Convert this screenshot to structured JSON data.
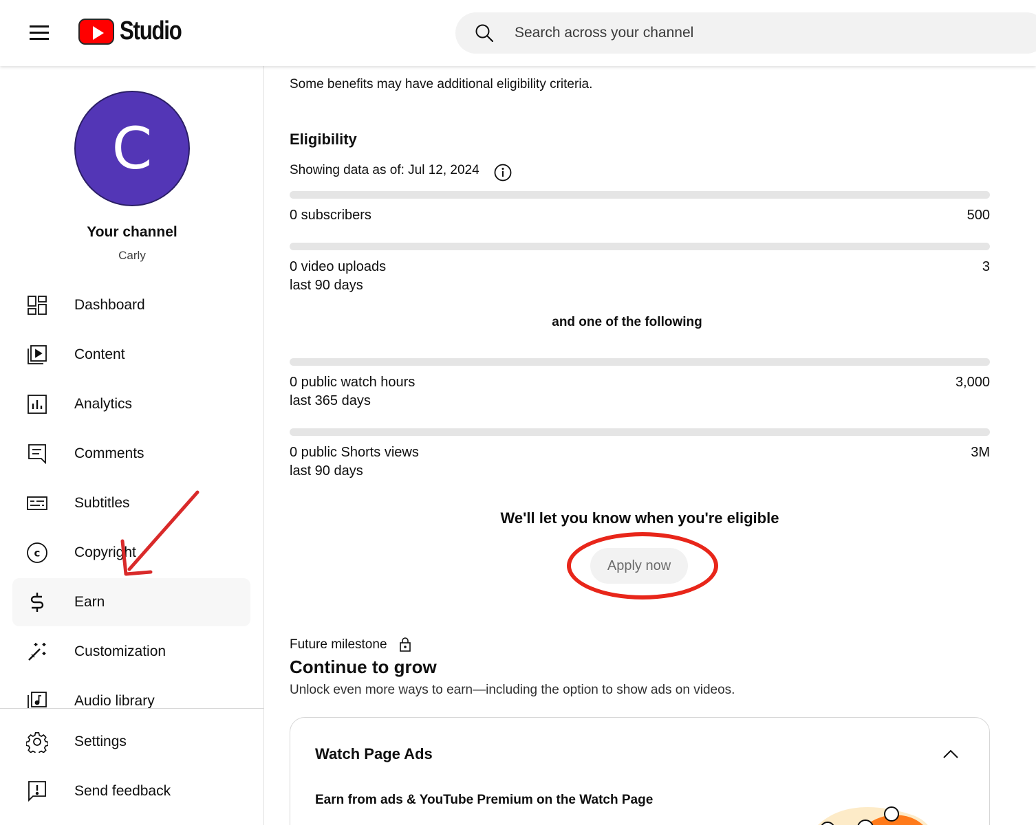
{
  "header": {
    "app_name": "Studio",
    "search_placeholder": "Search across your channel"
  },
  "sidebar": {
    "avatar_letter": "C",
    "channel_title": "Your channel",
    "channel_name": "Carly",
    "items": [
      {
        "label": "Dashboard",
        "icon": "dashboard-icon"
      },
      {
        "label": "Content",
        "icon": "content-icon"
      },
      {
        "label": "Analytics",
        "icon": "analytics-icon"
      },
      {
        "label": "Comments",
        "icon": "comments-icon"
      },
      {
        "label": "Subtitles",
        "icon": "subtitles-icon"
      },
      {
        "label": "Copyright",
        "icon": "copyright-icon"
      },
      {
        "label": "Earn",
        "icon": "dollar-icon",
        "active": true
      },
      {
        "label": "Customization",
        "icon": "magic-wand-icon"
      },
      {
        "label": "Audio library",
        "icon": "audio-library-icon"
      }
    ],
    "bottom_items": [
      {
        "label": "Settings",
        "icon": "gear-icon"
      },
      {
        "label": "Send feedback",
        "icon": "feedback-icon"
      }
    ]
  },
  "main": {
    "intro_text": "Some benefits may have additional eligibility criteria.",
    "eligibility_title": "Eligibility",
    "data_date": "Showing data as of: Jul 12, 2024",
    "requirements": [
      {
        "current": "0 subscribers",
        "period": "",
        "target": "500",
        "progress": 0
      },
      {
        "current": "0 video uploads",
        "period": "last 90 days",
        "target": "3",
        "progress": 0
      }
    ],
    "and_one_text": "and one of the following",
    "alternatives": [
      {
        "current": "0 public watch hours",
        "period": "last 365 days",
        "target": "3,000",
        "progress": 0
      },
      {
        "current": "0 public Shorts views",
        "period": "last 90 days",
        "target": "3M",
        "progress": 0
      }
    ],
    "notify_text": "We'll let you know when you're eligible",
    "apply_button": "Apply now",
    "future_label": "Future milestone",
    "future_title": "Continue to grow",
    "future_desc": "Unlock even more ways to earn—including the option to show ads on videos.",
    "card": {
      "title": "Watch Page Ads",
      "subtitle": "Earn from ads & YouTube Premium on the Watch Page"
    }
  },
  "colors": {
    "brand_red": "#ff0000",
    "avatar_purple": "#5336b6",
    "annotation_red": "#e8261a"
  }
}
